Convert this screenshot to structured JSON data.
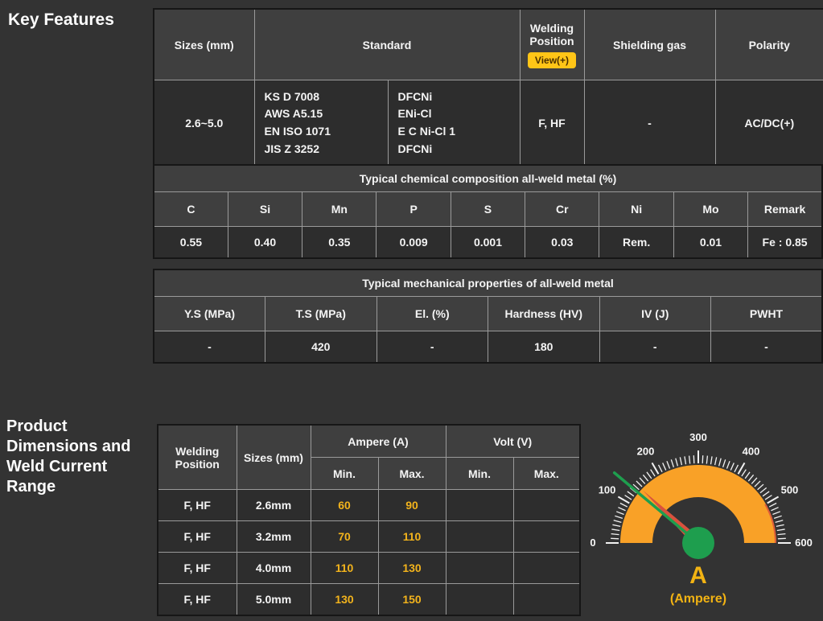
{
  "page": {
    "key_features_title": "Key Features",
    "product_dimensions_title": "Product Dimensions and Weld Current Range"
  },
  "spec_table": {
    "col_sizes": "Sizes (mm)",
    "col_standard": "Standard",
    "col_welding_position": "Welding Position",
    "view_button": "View(+)",
    "col_shielding_gas": "Shielding gas",
    "col_polarity": "Polarity",
    "row": {
      "sizes": "2.6~5.0",
      "standards_a": [
        "KS D 7008",
        "AWS A5.15",
        "EN ISO 1071",
        "JIS Z 3252"
      ],
      "standards_b": [
        "DFCNi",
        "ENi-Cl",
        "E C Ni-Cl 1",
        "DFCNi"
      ],
      "welding_position": "F, HF",
      "shielding_gas": "-",
      "polarity": "AC/DC(+)"
    }
  },
  "chemical_table": {
    "title": "Typical chemical composition all-weld metal (%)",
    "columns": [
      "C",
      "Si",
      "Mn",
      "P",
      "S",
      "Cr",
      "Ni",
      "Mo",
      "Remark"
    ],
    "values": [
      "0.55",
      "0.40",
      "0.35",
      "0.009",
      "0.001",
      "0.03",
      "Rem.",
      "0.01",
      "Fe : 0.85"
    ]
  },
  "mechanical_table": {
    "title": "Typical mechanical properties of all-weld metal",
    "columns": [
      "Y.S (MPa)",
      "T.S (MPa)",
      "El. (%)",
      "Hardness (HV)",
      "IV (J)",
      "PWHT"
    ],
    "values": [
      "-",
      "420",
      "-",
      "180",
      "-",
      "-"
    ]
  },
  "current_table": {
    "col_welding_position": "Welding Position",
    "col_sizes": "Sizes (mm)",
    "col_ampere": "Ampere (A)",
    "col_volt": "Volt (V)",
    "col_min": "Min.",
    "col_max": "Max.",
    "rows": [
      {
        "welding_position": "F, HF",
        "size": "2.6mm",
        "ampere_min": "60",
        "ampere_max": "90",
        "volt_min": "",
        "volt_max": ""
      },
      {
        "welding_position": "F, HF",
        "size": "3.2mm",
        "ampere_min": "70",
        "ampere_max": "110",
        "volt_min": "",
        "volt_max": ""
      },
      {
        "welding_position": "F, HF",
        "size": "4.0mm",
        "ampere_min": "110",
        "ampere_max": "130",
        "volt_min": "",
        "volt_max": ""
      },
      {
        "welding_position": "F, HF",
        "size": "5.0mm",
        "ampere_min": "130",
        "ampere_max": "150",
        "volt_min": "",
        "volt_max": ""
      }
    ]
  },
  "gauge": {
    "min": 0,
    "max": 600,
    "minor_step": 10,
    "major_step": 100,
    "tick_labels": [
      "0",
      "100",
      "200",
      "300",
      "400",
      "500",
      "600"
    ],
    "needle_value": 133,
    "pointer_value": 145,
    "red_zone_start": 500,
    "unit": "A",
    "unit_label": "(Ampere)",
    "arc_color": "#F9A127",
    "needle_color": "#1E9E4E",
    "pointer_color": "#D9513D"
  }
}
